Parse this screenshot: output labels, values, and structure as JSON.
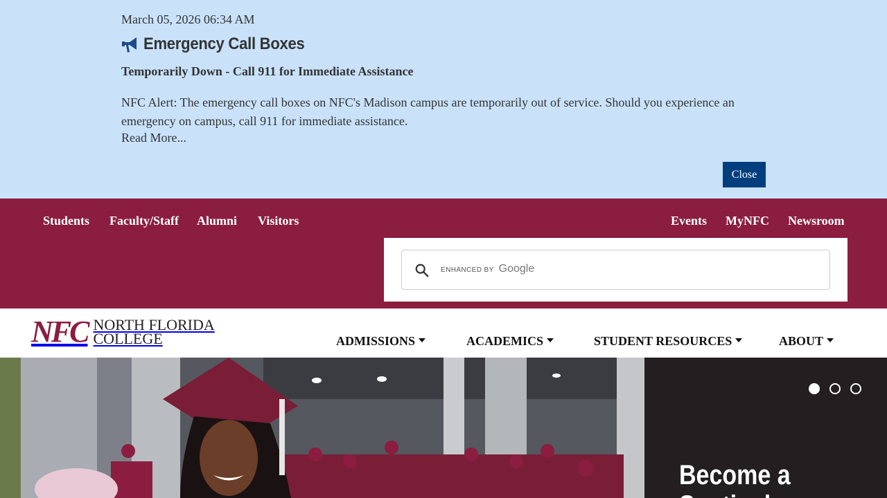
{
  "alert": {
    "date": "March 05, 2026 06:34 AM",
    "title": "Emergency Call Boxes",
    "subtitle": "Temporarily Down - Call 911 for Immediate Assistance",
    "body": "NFC Alert: The emergency call boxes on NFC's Madison campus are temporarily out of service. Should you experience an emergency on campus, call 911 for immediate assistance.",
    "read_more": "Read More...",
    "close_label": "Close",
    "icon": "megaphone-icon"
  },
  "utility_nav": {
    "left": [
      "Students",
      "Faculty/Staff",
      "Alumni",
      "Visitors"
    ],
    "right": [
      "Events",
      "MyNFC",
      "Newsroom"
    ]
  },
  "search": {
    "enhanced_by": "ENHANCED BY",
    "provider": "Google",
    "icon": "search-icon"
  },
  "logo": {
    "mark": "NFC",
    "line1": "NORTH FLORIDA",
    "line2": "COLLEGE"
  },
  "main_nav": [
    "ADMISSIONS",
    "ACADEMICS",
    "STUDENT RESOURCES",
    "ABOUT"
  ],
  "hero": {
    "heading": "Become a Sentinel",
    "slide_count": 3,
    "active_slide": 1
  },
  "colors": {
    "maroon": "#8b1d40",
    "alert_bg": "#c9e2fa",
    "button_blue": "#003e7e",
    "hero_panel": "#231f20"
  }
}
